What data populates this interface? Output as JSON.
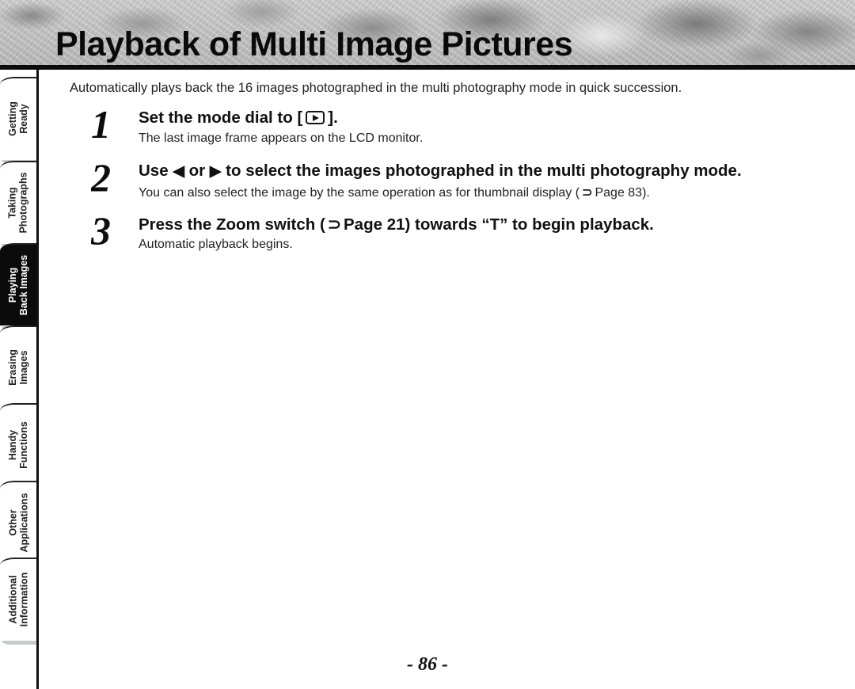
{
  "header": {
    "title": "Playback of Multi Image Pictures"
  },
  "side_tabs": [
    {
      "line1": "Getting",
      "line2": "Ready",
      "active": false
    },
    {
      "line1": "Taking",
      "line2": "Photographs",
      "active": false
    },
    {
      "line1": "Playing",
      "line2": "Back Images",
      "active": true
    },
    {
      "line1": "Erasing",
      "line2": "Images",
      "active": false
    },
    {
      "line1": "Handy",
      "line2": "Functions",
      "active": false
    },
    {
      "line1": "Other",
      "line2": "Applications",
      "active": false
    },
    {
      "line1": "Additional",
      "line2": "Information",
      "active": false
    }
  ],
  "intro": "Automatically plays back the 16 images photographed in the multi photography mode in quick succession.",
  "steps": [
    {
      "number": "1",
      "title_pre": "Set the mode dial to [",
      "title_icon": "playback-mode-icon",
      "title_post": "].",
      "description": "The last image frame appears on the LCD monitor."
    },
    {
      "number": "2",
      "title_pre": "Use",
      "left_arrow": "◀",
      "title_mid": "or",
      "right_arrow": "▶",
      "title_post": "to select the images photographed in the multi photography mode.",
      "description_pre": "You can also select the image by the same operation as for thumbnail display (",
      "ref_icon": "⊃",
      "description_ref": "Page 83",
      "description_post": ")."
    },
    {
      "number": "3",
      "title_pre": "Press the Zoom switch (",
      "ref_icon": "⊃",
      "title_ref": "Page 21",
      "title_post": ") towards “T” to begin playback.",
      "description": "Automatic playback begins."
    }
  ],
  "footer": {
    "page_number": "- 86 -"
  }
}
